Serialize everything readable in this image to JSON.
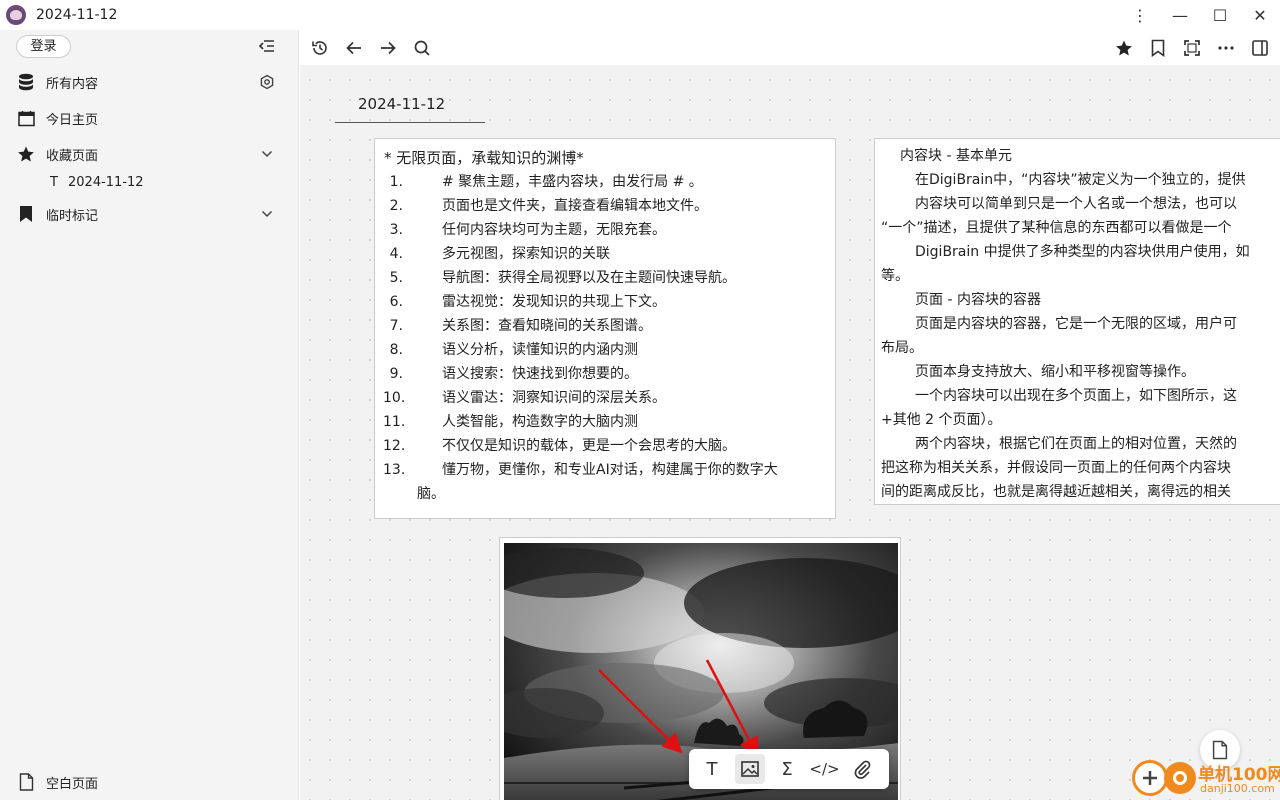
{
  "window": {
    "title": "2024-11-12",
    "controls": [
      "⋮",
      "—",
      "☐",
      "✕"
    ]
  },
  "sidebar": {
    "login_label": "登录",
    "items": [
      {
        "label": "所有内容",
        "icon": "database-icon"
      },
      {
        "label": "今日主页",
        "icon": "calendar-icon"
      },
      {
        "label": "收藏页面",
        "icon": "star-icon"
      },
      {
        "label": "临时标记",
        "icon": "bookmark-icon"
      }
    ],
    "favorite_child": {
      "type_glyph": "T",
      "label": "2024-11-12"
    },
    "bottom_item": {
      "label": "空白页面",
      "icon": "file-icon"
    }
  },
  "toolbar": {
    "left": [
      "history-icon",
      "back-arrow-icon",
      "forward-arrow-icon",
      "search-icon"
    ],
    "right": [
      "star-icon",
      "bookmark-icon",
      "fullscreen-icon",
      "more-icon",
      "panel-icon"
    ]
  },
  "page": {
    "date_title": "2024-11-12"
  },
  "card1": {
    "heading": "* 无限页面，承载知识的渊博*",
    "items": [
      {
        "n": "1.",
        "text": "# 聚焦主题，丰盛内容块，由发行局 # 。"
      },
      {
        "n": "2.",
        "text": "页面也是文件夹，直接查看编辑本地文件。"
      },
      {
        "n": "3.",
        "text": "任何内容块均可为主题，无限充套。"
      },
      {
        "n": "4.",
        "text": "多元视图，探索知识的关联"
      },
      {
        "n": "5.",
        "text": "导航图：获得全局视野以及在主题间快速导航。"
      },
      {
        "n": "6.",
        "text": "雷达视觉：发现知识的共现上下文。"
      },
      {
        "n": "7.",
        "text": "关系图：查看知晓间的关系图谱。"
      },
      {
        "n": "8.",
        "text": "语义分析，读懂知识的内涵内测"
      },
      {
        "n": "9.",
        "text": "语义搜索：快速找到你想要的。"
      },
      {
        "n": "10.",
        "text": "语义雷达：洞察知识间的深层关系。"
      },
      {
        "n": "11.",
        "text": "人类智能，构造数字的大脑内测"
      },
      {
        "n": "12.",
        "text": "不仅仅是知识的载体，更是一个会思考的大脑。"
      },
      {
        "n": "13.",
        "text": "懂万物，更懂你，和专业AI对话，构建属于你的数字大"
      },
      {
        "n": "",
        "text": "脑。"
      }
    ]
  },
  "card2": {
    "lines": [
      {
        "style": "h",
        "text": "内容块 - 基本单元"
      },
      {
        "style": "ind",
        "text": "在DigiBrain中，“内容块”被定义为一个独立的，提供"
      },
      {
        "style": "ind",
        "text": "内容块可以简单到只是一个人名或一个想法，也可以"
      },
      {
        "style": "",
        "text": "“一个”描述，且提供了某种信息的东西都可以看做是一个"
      },
      {
        "style": "ind",
        "text": "DigiBrain 中提供了多种类型的内容块供用户使用，如"
      },
      {
        "style": "",
        "text": "等。"
      },
      {
        "style": "ind",
        "text": "页面 - 内容块的容器"
      },
      {
        "style": "ind",
        "text": "页面是内容块的容器，它是一个无限的区域，用户可"
      },
      {
        "style": "",
        "text": "布局。"
      },
      {
        "style": "ind",
        "text": "页面本身支持放大、缩小和平移视窗等操作。"
      },
      {
        "style": "ind",
        "text": "一个内容块可以出现在多个页面上，如下图所示，这"
      },
      {
        "style": "",
        "text": "+其他 2 个页面）。"
      },
      {
        "style": "ind",
        "text": "两个内容块，根据它们在页面上的相对位置，天然的"
      },
      {
        "style": "",
        "text": "把这称为相关关系，并假设同一页面上的任何两个内容块"
      },
      {
        "style": "",
        "text": "间的距离成反比，也就是离得越近越相关，离得远的相关"
      }
    ]
  },
  "insert_toolbar": {
    "buttons": [
      {
        "glyph": "T",
        "icon": "text-icon"
      },
      {
        "glyph": "",
        "icon": "image-icon"
      },
      {
        "glyph": "Σ",
        "icon": "formula-icon"
      },
      {
        "glyph": "</>",
        "icon": "code-icon"
      },
      {
        "glyph": "",
        "icon": "attachment-icon"
      }
    ]
  },
  "watermark": {
    "text": "单机100网",
    "sub": "danji100.com"
  },
  "colors": {
    "sidebar_bg": "#f4f4f4",
    "canvas_bg": "#f2f2f2",
    "arrow": "#e01010",
    "watermark": "#f08a1c"
  }
}
